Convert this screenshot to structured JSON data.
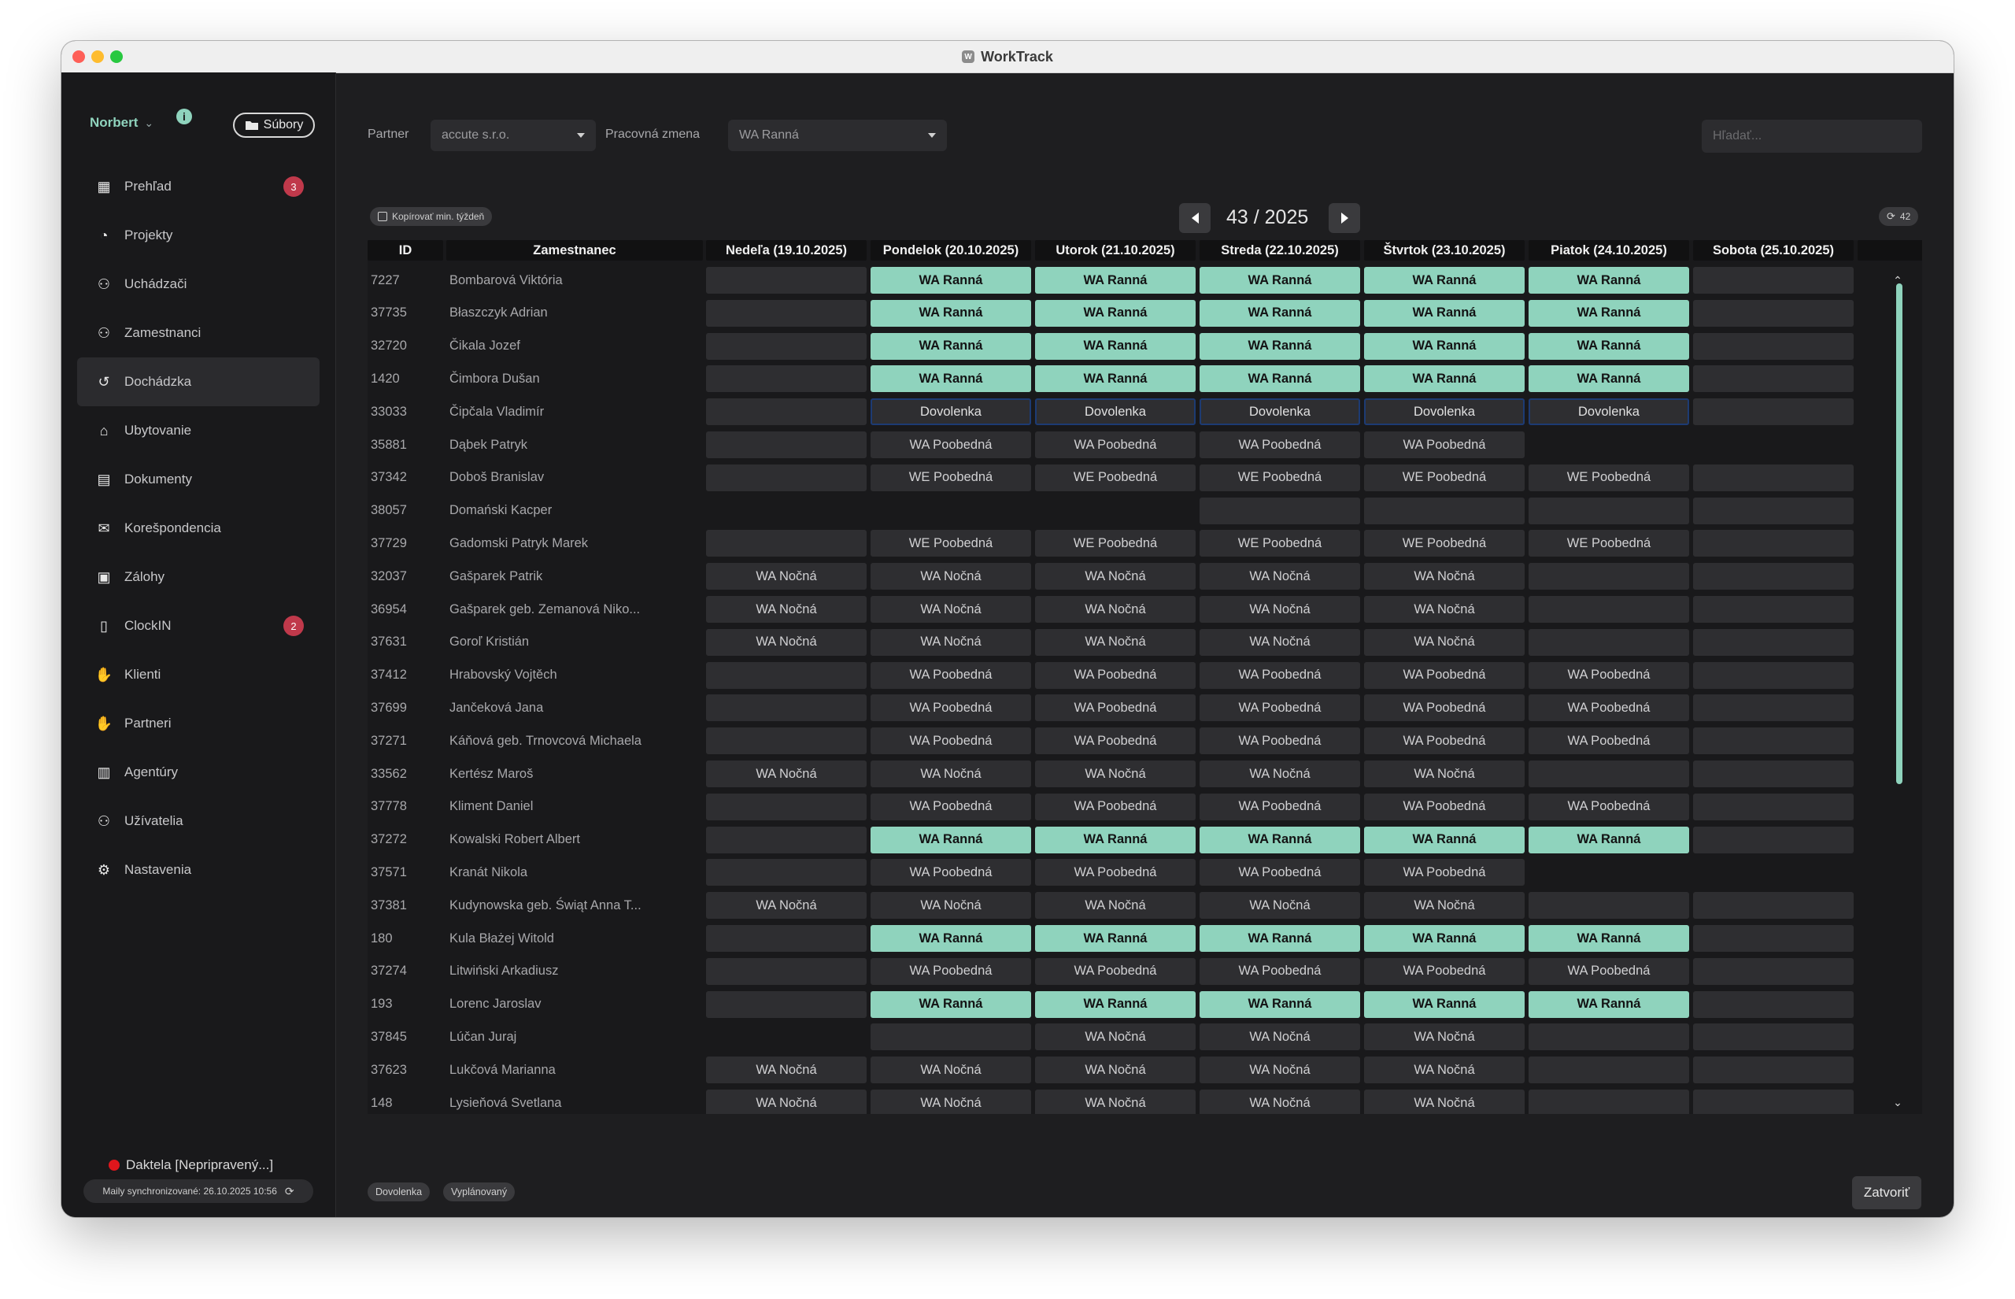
{
  "window": {
    "title": "WorkTrack",
    "app_icon": "W"
  },
  "sidebar": {
    "user": "Norbert",
    "files_label": "Súbory",
    "items": [
      {
        "label": "Prehľad",
        "icon": "dashboard-icon",
        "badge": "3"
      },
      {
        "label": "Projekty",
        "icon": "projects-icon"
      },
      {
        "label": "Uchádzači",
        "icon": "candidates-icon"
      },
      {
        "label": "Zamestnanci",
        "icon": "employees-icon"
      },
      {
        "label": "Dochádzka",
        "icon": "history-icon",
        "active": true
      },
      {
        "label": "Ubytovanie",
        "icon": "house-icon"
      },
      {
        "label": "Dokumenty",
        "icon": "documents-icon"
      },
      {
        "label": "Korešpondencia",
        "icon": "envelope-icon"
      },
      {
        "label": "Zálohy",
        "icon": "money-icon"
      },
      {
        "label": "ClockIN",
        "icon": "phone-icon",
        "badge": "2"
      },
      {
        "label": "Klienti",
        "icon": "handshake-icon"
      },
      {
        "label": "Partneri",
        "icon": "partners-icon"
      },
      {
        "label": "Agentúry",
        "icon": "building-icon"
      },
      {
        "label": "Užívatelia",
        "icon": "users-icon"
      },
      {
        "label": "Nastavenia",
        "icon": "gears-icon"
      }
    ],
    "daktela": "Daktela [Nepripravený...]",
    "mail_sync": "Maily synchronizované: 26.10.2025 10:56"
  },
  "filters": {
    "partner_label": "Partner",
    "partner_value": "accute s.r.o.",
    "shift_label": "Pracovná zmena",
    "shift_value": "WA Ranná",
    "search_placeholder": "Hľadať..."
  },
  "toolbar": {
    "copy_label": "Kopírovať min. týždeň",
    "week": "43 / 2025",
    "refresh_count": "42"
  },
  "table": {
    "headers": [
      "ID",
      "Zamestnanec",
      "Nedeľa (19.10.2025)",
      "Pondelok (20.10.2025)",
      "Utorok (21.10.2025)",
      "Streda (22.10.2025)",
      "Štvrtok (23.10.2025)",
      "Piatok (24.10.2025)",
      "Sobota (25.10.2025)",
      ""
    ],
    "rows": [
      {
        "id": "7227",
        "name": "Bombarová Viktória",
        "days": [
          "",
          "WA Ranná",
          "WA Ranná",
          "WA Ranná",
          "WA Ranná",
          "WA Ranná",
          ""
        ]
      },
      {
        "id": "37735",
        "name": "Błaszczyk Adrian",
        "days": [
          "",
          "WA Ranná",
          "WA Ranná",
          "WA Ranná",
          "WA Ranná",
          "WA Ranná",
          ""
        ]
      },
      {
        "id": "32720",
        "name": "Čikala Jozef",
        "days": [
          "",
          "WA Ranná",
          "WA Ranná",
          "WA Ranná",
          "WA Ranná",
          "WA Ranná",
          ""
        ]
      },
      {
        "id": "1420",
        "name": "Čimbora Dušan",
        "days": [
          "",
          "WA Ranná",
          "WA Ranná",
          "WA Ranná",
          "WA Ranná",
          "WA Ranná",
          ""
        ]
      },
      {
        "id": "33033",
        "name": "Čipčala Vladimír",
        "days": [
          "",
          "Dovolenka",
          "Dovolenka",
          "Dovolenka",
          "Dovolenka",
          "Dovolenka",
          ""
        ]
      },
      {
        "id": "35881",
        "name": "Dąbek Patryk",
        "days": [
          "",
          "WA Poobedná",
          "WA Poobedná",
          "WA Poobedná",
          "WA Poobedná",
          null,
          null
        ]
      },
      {
        "id": "37342",
        "name": "Doboš Branislav",
        "days": [
          "",
          "WE Poobedná",
          "WE Poobedná",
          "WE Poobedná",
          "WE Poobedná",
          "WE Poobedná",
          ""
        ]
      },
      {
        "id": "38057",
        "name": "Domański Kacper",
        "days": [
          null,
          null,
          null,
          "",
          "",
          "",
          ""
        ]
      },
      {
        "id": "37729",
        "name": "Gadomski Patryk Marek",
        "days": [
          "",
          "WE Poobedná",
          "WE Poobedná",
          "WE Poobedná",
          "WE Poobedná",
          "WE Poobedná",
          ""
        ]
      },
      {
        "id": "32037",
        "name": "Gašparek Patrik",
        "days": [
          "WA Nočná",
          "WA Nočná",
          "WA Nočná",
          "WA Nočná",
          "WA Nočná",
          "",
          ""
        ]
      },
      {
        "id": "36954",
        "name": "Gašparek  geb. Zemanová Niko...",
        "days": [
          "WA Nočná",
          "WA Nočná",
          "WA Nočná",
          "WA Nočná",
          "WA Nočná",
          "",
          ""
        ]
      },
      {
        "id": "37631",
        "name": "Goroľ Kristián",
        "days": [
          "WA Nočná",
          "WA Nočná",
          "WA Nočná",
          "WA Nočná",
          "WA Nočná",
          "",
          ""
        ]
      },
      {
        "id": "37412",
        "name": "Hrabovský Vojtěch",
        "days": [
          "",
          "WA Poobedná",
          "WA Poobedná",
          "WA Poobedná",
          "WA Poobedná",
          "WA Poobedná",
          ""
        ]
      },
      {
        "id": "37699",
        "name": "Jančeková Jana",
        "days": [
          "",
          "WA Poobedná",
          "WA Poobedná",
          "WA Poobedná",
          "WA Poobedná",
          "WA Poobedná",
          ""
        ]
      },
      {
        "id": "37271",
        "name": "Káňová geb. Trnovcová Michaela",
        "days": [
          "",
          "WA Poobedná",
          "WA Poobedná",
          "WA Poobedná",
          "WA Poobedná",
          "WA Poobedná",
          ""
        ]
      },
      {
        "id": "33562",
        "name": "Kertész Maroš",
        "days": [
          "WA Nočná",
          "WA Nočná",
          "WA Nočná",
          "WA Nočná",
          "WA Nočná",
          "",
          ""
        ]
      },
      {
        "id": "37778",
        "name": "Kliment Daniel",
        "days": [
          "",
          "WA Poobedná",
          "WA Poobedná",
          "WA Poobedná",
          "WA Poobedná",
          "WA Poobedná",
          ""
        ]
      },
      {
        "id": "37272",
        "name": "Kowalski Robert Albert",
        "days": [
          "",
          "WA Ranná",
          "WA Ranná",
          "WA Ranná",
          "WA Ranná",
          "WA Ranná",
          ""
        ]
      },
      {
        "id": "37571",
        "name": "Kranát Nikola",
        "days": [
          "",
          "WA Poobedná",
          "WA Poobedná",
          "WA Poobedná",
          "WA Poobedná",
          null,
          null
        ]
      },
      {
        "id": "37381",
        "name": "Kudynowska geb. Świąt Anna T...",
        "days": [
          "WA Nočná",
          "WA Nočná",
          "WA Nočná",
          "WA Nočná",
          "WA Nočná",
          "",
          ""
        ]
      },
      {
        "id": "180",
        "name": "Kula Błażej Witold",
        "days": [
          "",
          "WA Ranná",
          "WA Ranná",
          "WA Ranná",
          "WA Ranná",
          "WA Ranná",
          ""
        ]
      },
      {
        "id": "37274",
        "name": "Litwiński Arkadiusz",
        "days": [
          "",
          "WA Poobedná",
          "WA Poobedná",
          "WA Poobedná",
          "WA Poobedná",
          "WA Poobedná",
          ""
        ]
      },
      {
        "id": "193",
        "name": "Lorenc Jaroslav",
        "days": [
          "",
          "WA Ranná",
          "WA Ranná",
          "WA Ranná",
          "WA Ranná",
          "WA Ranná",
          ""
        ]
      },
      {
        "id": "37845",
        "name": "Lúčan Juraj",
        "days": [
          null,
          "",
          "WA Nočná",
          "WA Nočná",
          "WA Nočná",
          "",
          ""
        ]
      },
      {
        "id": "37623",
        "name": "Lukčová Marianna",
        "days": [
          "WA Nočná",
          "WA Nočná",
          "WA Nočná",
          "WA Nočná",
          "WA Nočná",
          "",
          ""
        ]
      },
      {
        "id": "148",
        "name": "Lysieňová Svetlana",
        "days": [
          "WA Nočná",
          "WA Nočná",
          "WA Nočná",
          "WA Nočná",
          "WA Nočná",
          "",
          ""
        ]
      }
    ]
  },
  "legend": [
    "Dovolenka",
    "Vyplánovaný"
  ],
  "close_label": "Zatvoriť",
  "colors": {
    "accent": "#8fd3bd",
    "cell": "#2e2e31",
    "badge": "#c0394b",
    "vacation_border": "#1d3b73"
  }
}
